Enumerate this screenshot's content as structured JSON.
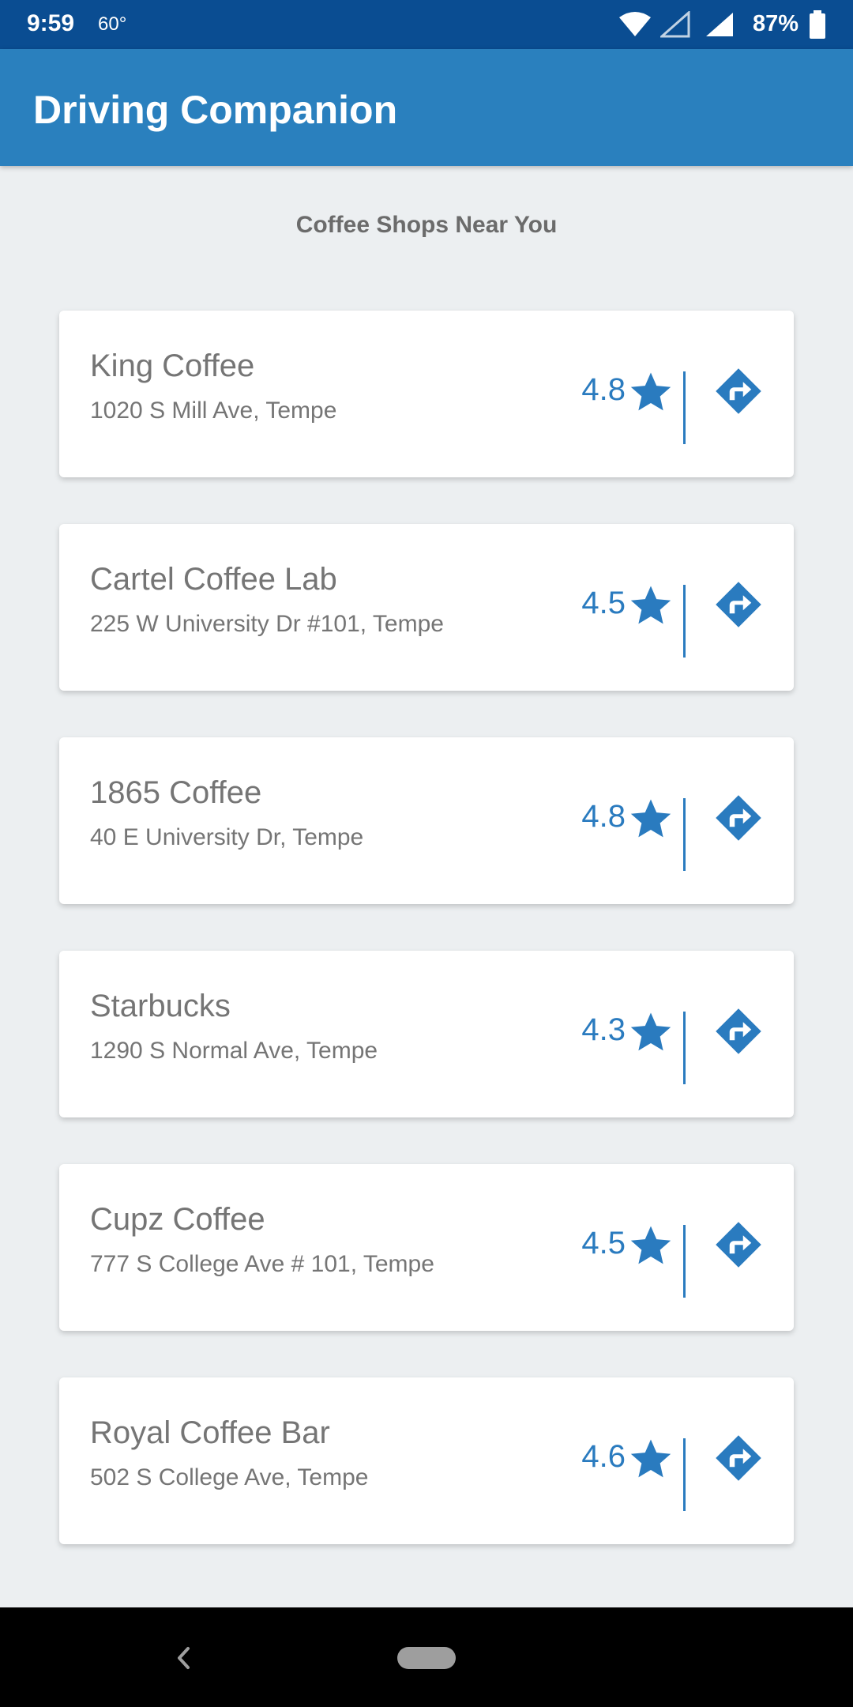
{
  "status_bar": {
    "time": "9:59",
    "temperature": "60°",
    "battery": "87%",
    "icons": [
      "wifi-icon",
      "signal-empty-icon",
      "signal-icon",
      "battery-icon"
    ]
  },
  "app": {
    "title": "Driving Companion"
  },
  "section": {
    "title": "Coffee Shops Near You"
  },
  "shops": [
    {
      "name": "King Coffee",
      "address": "1020 S Mill Ave, Tempe",
      "rating": "4.8"
    },
    {
      "name": "Cartel Coffee Lab",
      "address": "225 W University Dr #101, Tempe",
      "rating": "4.5"
    },
    {
      "name": "1865 Coffee",
      "address": "40 E University Dr, Tempe",
      "rating": "4.8"
    },
    {
      "name": "Starbucks",
      "address": "1290 S Normal Ave, Tempe",
      "rating": "4.3"
    },
    {
      "name": "Cupz Coffee",
      "address": "777 S College Ave # 101, Tempe",
      "rating": "4.5"
    },
    {
      "name": "Royal Coffee Bar",
      "address": "502 S College Ave, Tempe",
      "rating": "4.6"
    }
  ],
  "icons": {
    "rating": "star-icon",
    "directions": "directions-icon"
  },
  "colors": {
    "status_bar": "#0a4d92",
    "app_bar": "#2a80be",
    "accent": "#2a7bbf",
    "background": "#eceff1"
  }
}
